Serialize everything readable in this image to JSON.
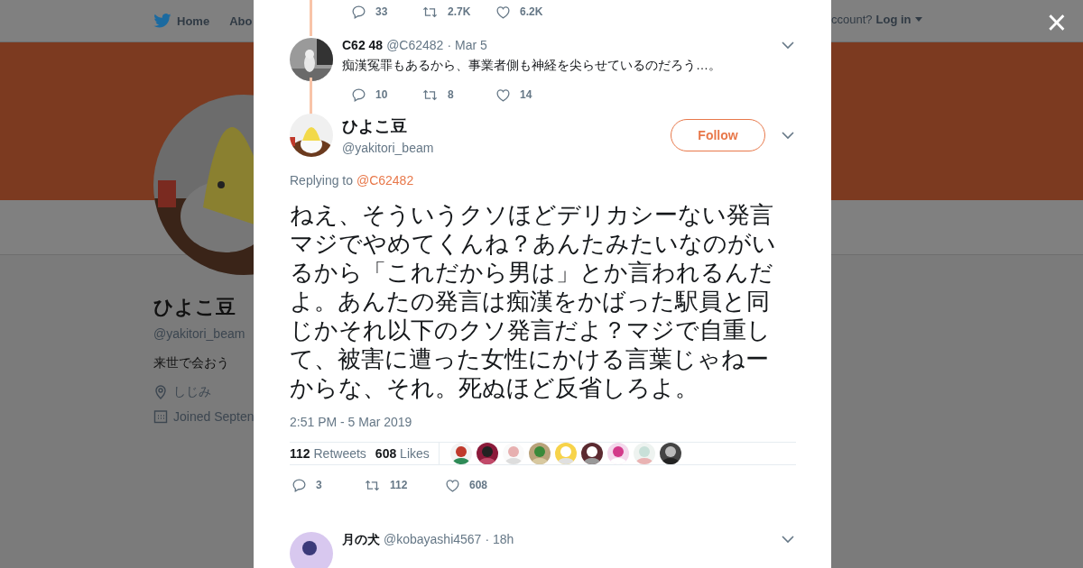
{
  "background": {
    "nav": {
      "home": "Home",
      "about": "Abo",
      "account": "ccount?",
      "login": "Log in"
    },
    "profile": {
      "name": "ひよこ豆",
      "handle": "@yakitori_beam",
      "bio": "来世で会おう",
      "location": "しじみ",
      "joined": "Joined Septen"
    }
  },
  "close": {
    "label": "×"
  },
  "thread": {
    "prev_actions": {
      "replies": "33",
      "retweets": "2.7K",
      "likes": "6.2K"
    },
    "parent": {
      "name": "C62 48",
      "handle": "@C62482",
      "date": "· Mar 5",
      "text": "痴漢冤罪もあるから、事業者側も神経を尖らせているのだろう…。",
      "replies": "10",
      "retweets": "8",
      "likes": "14"
    }
  },
  "tweet": {
    "name": "ひよこ豆",
    "handle": "@yakitori_beam",
    "follow": "Follow",
    "replying_label": "Replying to",
    "replying_to": "@C62482",
    "text": "ねえ、そういうクソほどデリカシーない発言マジでやめてくんね？あんたみたいなのがいるから「これだから男は」とか言われるんだよ。あんたの発言は痴漢をかばった駅員と同じかそれ以下のクソ発言だよ？マジで自重して、被害に遭った女性にかける言葉じゃねーからな、それ。死ぬほど反省しろよ。",
    "time": "2:51 PM - 5 Mar 2019",
    "retweet_count": "112",
    "retweet_label": "Retweets",
    "like_count": "608",
    "like_label": "Likes",
    "replies": "3",
    "retweets": "112",
    "likes": "608"
  },
  "next_reply": {
    "name": "月の犬",
    "handle": "@kobayashi4567",
    "date": "· 18h"
  }
}
